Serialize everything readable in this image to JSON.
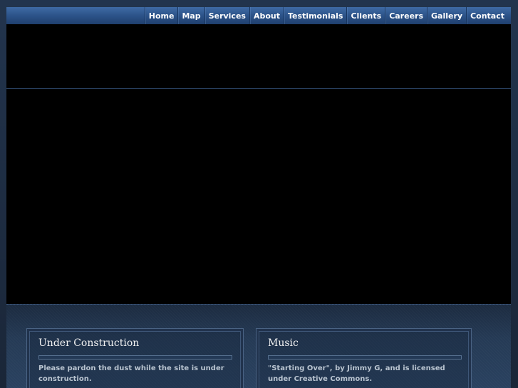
{
  "nav": {
    "items": [
      {
        "label": "Home"
      },
      {
        "label": "Map"
      },
      {
        "label": "Services"
      },
      {
        "label": "About"
      },
      {
        "label": "Testimonials"
      },
      {
        "label": "Clients"
      },
      {
        "label": "Careers"
      },
      {
        "label": "Gallery"
      },
      {
        "label": "Contact"
      }
    ]
  },
  "panels": {
    "construction": {
      "title": "Under Construction",
      "text": "Please pardon the dust while the site is under construction."
    },
    "music": {
      "title": "Music",
      "text": "\"Starting Over\", by Jimmy G, and is licensed under Creative Commons."
    }
  },
  "colors": {
    "nav_top": "#3f6aa4",
    "nav_bottom": "#1f3f6d",
    "content_background": "#253a55",
    "panel_border": "#4a6384",
    "panel_text": "#b9c4d0"
  }
}
